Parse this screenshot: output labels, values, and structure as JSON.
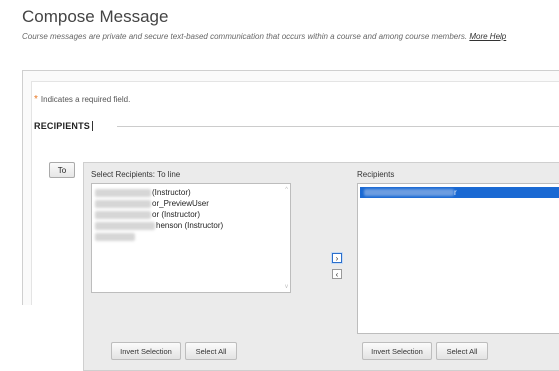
{
  "page": {
    "title": "Compose Message",
    "description": "Course messages are private and secure text-based communication that occurs within a course and among course members.",
    "help_link": "More Help"
  },
  "form": {
    "required_star": "*",
    "required_note": "Indicates a required field.",
    "section_title": "RECIPIENTS"
  },
  "recipients": {
    "to_button": "To",
    "select_label": "Select Recipients: To line",
    "available": [
      {
        "suffix": "(Instructor)"
      },
      {
        "suffix": "or_PreviewUser"
      },
      {
        "suffix": "or (Instructor)"
      },
      {
        "suffix": "henson (Instructor)"
      },
      {
        "suffix": ""
      }
    ],
    "move_right": "›",
    "move_left": "‹",
    "selected_label": "Recipients",
    "selected": [
      {
        "suffix": "r"
      }
    ],
    "invert_selection": "Invert Selection",
    "select_all": "Select All",
    "invert_selection_right": "Invert Selection",
    "select_all_right": "Select All",
    "scroll_up_glyph": "^",
    "scroll_down_glyph": "v"
  },
  "colors": {
    "required_star": "#e87722",
    "selection_highlight": "#1a69d3",
    "arrow_focus": "#2a6ecb"
  }
}
